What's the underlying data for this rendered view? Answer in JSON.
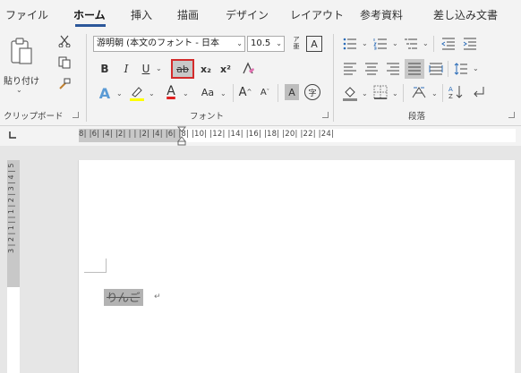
{
  "tabs": [
    "ファイル",
    "ホーム",
    "挿入",
    "描画",
    "デザイン",
    "レイアウト",
    "参考資料",
    "差し込み文書"
  ],
  "active_tab": "ホーム",
  "clipboard": {
    "group_label": "クリップボード",
    "paste_label": "貼り付け"
  },
  "font": {
    "group_label": "フォント",
    "font_name": "游明朝 (本文のフォント - 日本",
    "font_size": "10.5",
    "bold": "B",
    "italic": "I",
    "underline": "U",
    "strikethrough": "ab",
    "subscript": "x₂",
    "superscript": "x²",
    "change_case": "Aa",
    "grow_font": "A",
    "shrink_font": "A",
    "char_border": "A",
    "enclose_char": "字",
    "text_effect": "A",
    "font_color": "A",
    "phonetic_top": "ア",
    "phonetic_bottom": "亜",
    "strikethrough_active_border": "#d32b2b",
    "highlight_color": "#ffff00",
    "font_color_bar": "#e02020"
  },
  "paragraph": {
    "group_label": "段落"
  },
  "ruler": {
    "horizontal": "8| |6| |4| |2| |  | |2| |4| |6| |8| |10| |12| |14| |16| |18| |20| |22| |24|",
    "vertical": "3 | 2 | 1 |  | 1 | 2 | 3 | 4 | 5"
  },
  "document": {
    "text": "りんご",
    "paragraph_mark": "↵"
  },
  "colors": {
    "ribbon_bg": "#f3f3f3",
    "accent": "#2b579a",
    "selection": "#b3b3b3",
    "canvas": "#e6e6e6"
  }
}
